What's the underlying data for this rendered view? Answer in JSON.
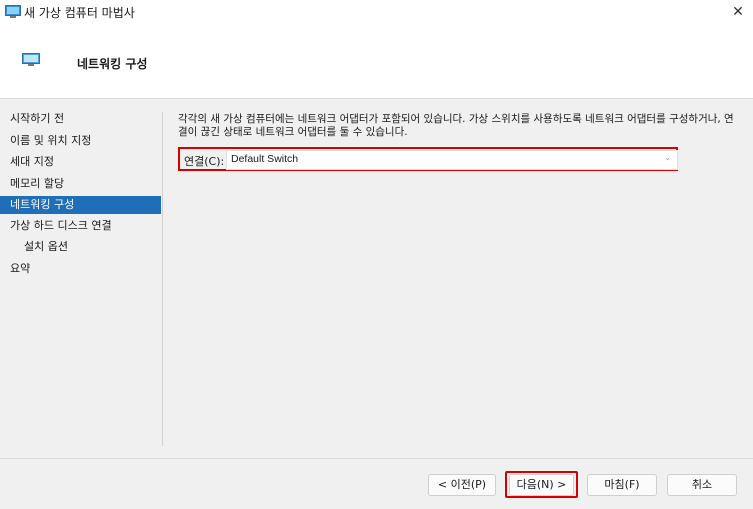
{
  "window": {
    "title": "새 가상 컴퓨터 마법사"
  },
  "header": {
    "title": "네트워킹 구성"
  },
  "sidebar": {
    "items": [
      {
        "label": "시작하기 전"
      },
      {
        "label": "이름 및 위치 지정"
      },
      {
        "label": "세대 지정"
      },
      {
        "label": "메모리 할당"
      },
      {
        "label": "네트워킹 구성",
        "active": true
      },
      {
        "label": "가상 하드 디스크 연결"
      },
      {
        "label": "설치 옵션"
      },
      {
        "label": "요약"
      }
    ]
  },
  "main": {
    "description": "각각의 새 가상 컴퓨터에는 네트워크 어댑터가 포함되어 있습니다. 가상 스위치를 사용하도록 네트워크 어댑터를 구성하거나, 연결이 끊긴 상태로 네트워크 어댑터를 둘 수 있습니다.",
    "connection_label": "연결(C):",
    "connection_value": "Default Switch"
  },
  "buttons": {
    "prev": "< 이전(P)",
    "next": "다음(N) >",
    "finish": "마침(F)",
    "cancel": "취소"
  },
  "colors": {
    "accent": "#1e6fb8",
    "highlight": "#d60000"
  },
  "icons": {
    "window": "monitor-icon",
    "header": "monitor-icon",
    "close": "close-icon",
    "dropdown": "chevron-down-icon"
  }
}
